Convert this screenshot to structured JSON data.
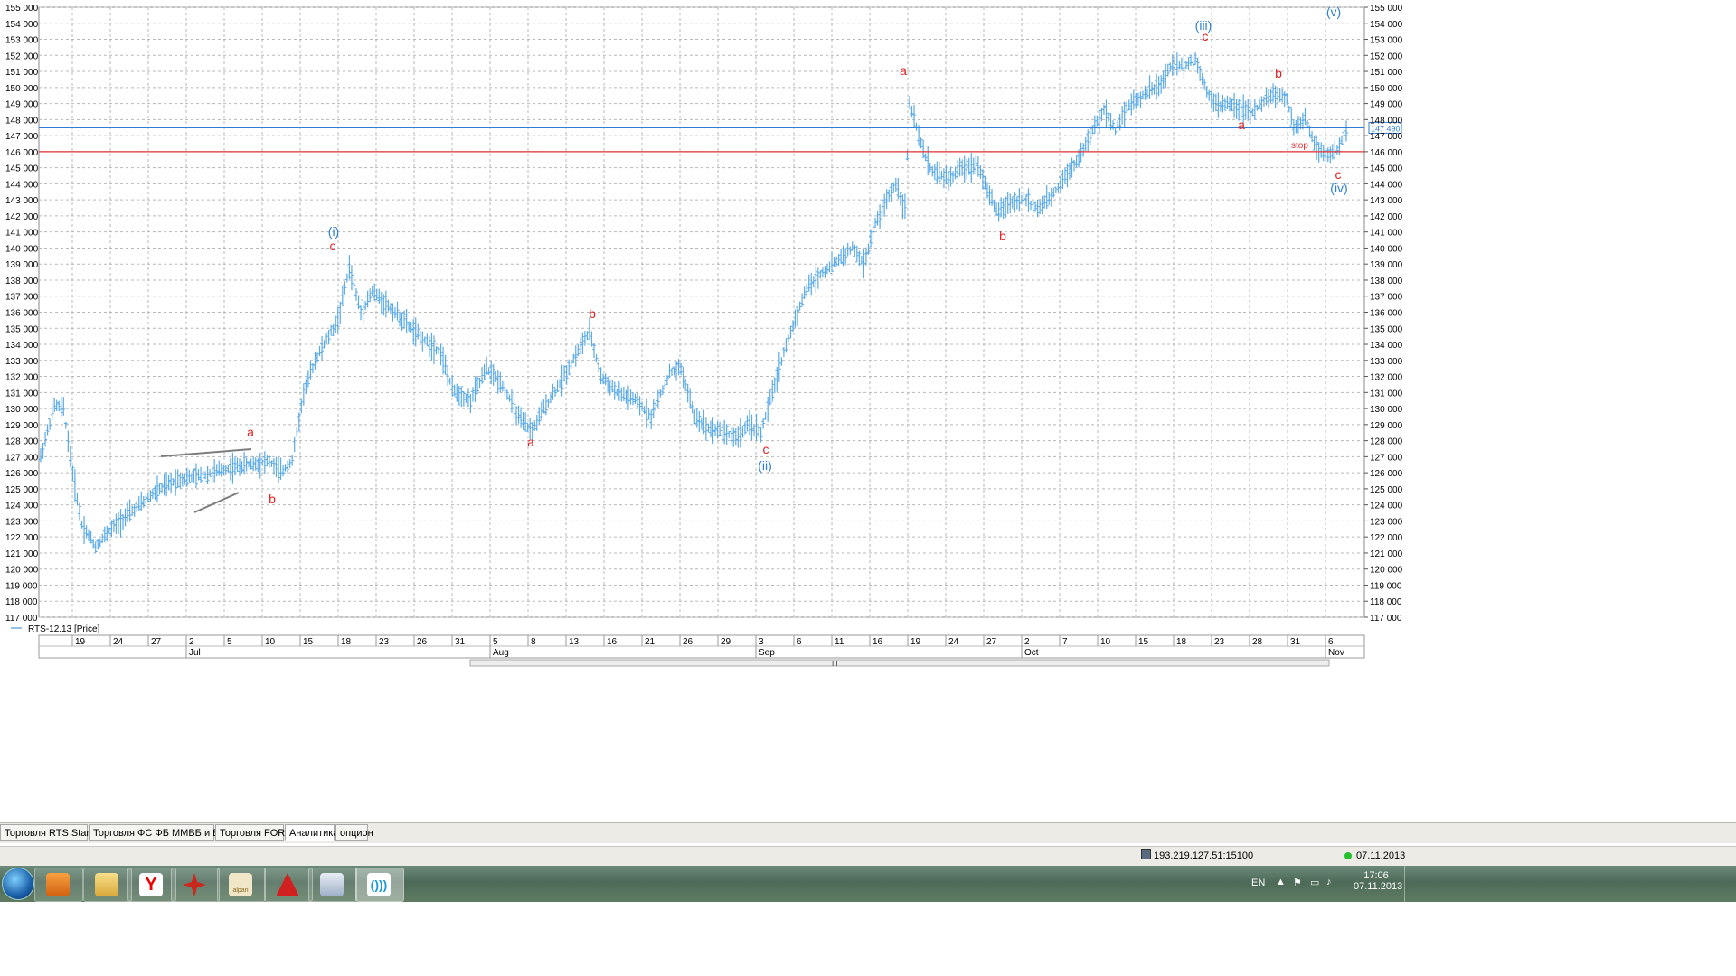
{
  "chart_data": {
    "type": "candlestick",
    "series_label": "RTS-12.13 [Price]",
    "ylim": [
      117000,
      155000
    ],
    "y_ticks": [
      "117 000",
      "118 000",
      "119 000",
      "120 000",
      "121 000",
      "122 000",
      "123 000",
      "124 000",
      "125 000",
      "126 000",
      "127 000",
      "128 000",
      "129 000",
      "130 000",
      "131 000",
      "132 000",
      "133 000",
      "134 000",
      "135 000",
      "136 000",
      "137 000",
      "138 000",
      "139 000",
      "140 000",
      "141 000",
      "142 000",
      "143 000",
      "144 000",
      "145 000",
      "146 000",
      "147 000",
      "148 000",
      "149 000",
      "150 000",
      "151 000",
      "152 000",
      "153 000",
      "154 000",
      "155 000"
    ],
    "x_day_labels": [
      "19",
      "24",
      "27",
      "2",
      "5",
      "10",
      "15",
      "18",
      "23",
      "26",
      "31",
      "5",
      "8",
      "13",
      "16",
      "21",
      "26",
      "29",
      "3",
      "6",
      "11",
      "16",
      "19",
      "24",
      "27",
      "2",
      "7",
      "10",
      "15",
      "18",
      "23",
      "28",
      "31",
      "6"
    ],
    "x_month_labels": [
      "Jul",
      "Aug",
      "Sep",
      "Oct",
      "Nov"
    ],
    "current_price_label": "147 490",
    "horizontal_lines": [
      {
        "value": 147490,
        "color": "#2e7fd4"
      },
      {
        "value": 146000,
        "color": "#e03030",
        "label": "stop"
      }
    ],
    "price_path_keypoints": [
      [
        0,
        127000
      ],
      [
        6,
        130200
      ],
      [
        10,
        130000
      ],
      [
        14,
        126000
      ],
      [
        18,
        122800
      ],
      [
        24,
        121400
      ],
      [
        30,
        122400
      ],
      [
        40,
        123600
      ],
      [
        50,
        124800
      ],
      [
        60,
        125600
      ],
      [
        70,
        125800
      ],
      [
        80,
        126200
      ],
      [
        90,
        126500
      ],
      [
        100,
        126700
      ],
      [
        105,
        126000
      ],
      [
        110,
        126800
      ],
      [
        115,
        131000
      ],
      [
        120,
        133000
      ],
      [
        130,
        135500
      ],
      [
        135,
        138800
      ],
      [
        140,
        136000
      ],
      [
        145,
        137300
      ],
      [
        155,
        136000
      ],
      [
        165,
        134600
      ],
      [
        175,
        133500
      ],
      [
        180,
        131200
      ],
      [
        188,
        130500
      ],
      [
        195,
        132500
      ],
      [
        202,
        131500
      ],
      [
        210,
        129200
      ],
      [
        215,
        128600
      ],
      [
        220,
        130000
      ],
      [
        228,
        131800
      ],
      [
        235,
        133600
      ],
      [
        240,
        134800
      ],
      [
        245,
        132000
      ],
      [
        252,
        131000
      ],
      [
        260,
        130500
      ],
      [
        267,
        129500
      ],
      [
        275,
        132200
      ],
      [
        280,
        132500
      ],
      [
        286,
        129500
      ],
      [
        292,
        128800
      ],
      [
        298,
        128600
      ],
      [
        304,
        128200
      ],
      [
        310,
        129000
      ],
      [
        315,
        128500
      ],
      [
        320,
        131000
      ],
      [
        325,
        133500
      ],
      [
        330,
        135600
      ],
      [
        335,
        137500
      ],
      [
        342,
        138500
      ],
      [
        350,
        139400
      ],
      [
        355,
        140000
      ],
      [
        360,
        139000
      ],
      [
        365,
        141500
      ],
      [
        370,
        143000
      ],
      [
        374,
        144000
      ],
      [
        378,
        142500
      ],
      [
        380,
        149000
      ],
      [
        382,
        148000
      ],
      [
        386,
        146000
      ],
      [
        390,
        144800
      ],
      [
        397,
        144300
      ],
      [
        403,
        145000
      ],
      [
        410,
        145200
      ],
      [
        414,
        143600
      ],
      [
        418,
        142300
      ],
      [
        424,
        142800
      ],
      [
        430,
        143100
      ],
      [
        436,
        142400
      ],
      [
        442,
        143200
      ],
      [
        448,
        144500
      ],
      [
        454,
        145600
      ],
      [
        460,
        147300
      ],
      [
        465,
        148600
      ],
      [
        470,
        147400
      ],
      [
        475,
        148800
      ],
      [
        480,
        149300
      ],
      [
        485,
        149800
      ],
      [
        490,
        150200
      ],
      [
        495,
        151500
      ],
      [
        500,
        151400
      ],
      [
        505,
        151800
      ],
      [
        510,
        149800
      ],
      [
        515,
        148800
      ],
      [
        520,
        149000
      ],
      [
        525,
        148700
      ],
      [
        530,
        148400
      ],
      [
        535,
        149200
      ],
      [
        540,
        149600
      ],
      [
        545,
        149300
      ],
      [
        548,
        147400
      ],
      [
        553,
        148100
      ],
      [
        557,
        146500
      ],
      [
        562,
        145800
      ],
      [
        567,
        146000
      ],
      [
        571,
        147400
      ]
    ],
    "wave_labels": [
      {
        "text": "a",
        "color": "#e02020",
        "x": 277,
        "y": 483
      },
      {
        "text": "b",
        "color": "#e02020",
        "x": 301,
        "y": 557
      },
      {
        "text": "c",
        "color": "#e02020",
        "x": 368,
        "y": 277
      },
      {
        "text": "(i)",
        "color": "#2e7fd4",
        "x": 369,
        "y": 261
      },
      {
        "text": "a",
        "color": "#e02020",
        "x": 587,
        "y": 494
      },
      {
        "text": "b",
        "color": "#e02020",
        "x": 655,
        "y": 352
      },
      {
        "text": "c",
        "color": "#e02020",
        "x": 847,
        "y": 502
      },
      {
        "text": "(ii)",
        "color": "#2e7fd4",
        "x": 846,
        "y": 520
      },
      {
        "text": "a",
        "color": "#e02020",
        "x": 999,
        "y": 83
      },
      {
        "text": "b",
        "color": "#e02020",
        "x": 1109,
        "y": 266
      },
      {
        "text": "c",
        "color": "#e02020",
        "x": 1333,
        "y": 45
      },
      {
        "text": "(iii)",
        "color": "#2e7fd4",
        "x": 1331,
        "y": 33
      },
      {
        "text": "a",
        "color": "#e02020",
        "x": 1373,
        "y": 143
      },
      {
        "text": "b",
        "color": "#e02020",
        "x": 1414,
        "y": 86
      },
      {
        "text": "c",
        "color": "#e02020",
        "x": 1480,
        "y": 198
      },
      {
        "text": "(iv)",
        "color": "#2e7fd4",
        "x": 1481,
        "y": 213
      },
      {
        "text": "(v)",
        "color": "#2e7fd4",
        "x": 1475,
        "y": 18
      }
    ]
  },
  "tabs": [
    "Торговля RTS Standard",
    "Торговля ФС ФБ ММВБ и БР РТС",
    "Торговля FORTS",
    "Аналитика",
    "опцион"
  ],
  "active_tab": 3,
  "status": {
    "connection": "193.219.127.51:15100",
    "date": "07.11.2013"
  },
  "taskbar": {
    "language": "EN",
    "time": "17:06",
    "date": "07.11.2013",
    "apps": [
      "start-orb",
      "media-player",
      "file-explorer",
      "yandex-browser",
      "trading-terminal",
      "alpari",
      "red-triangle-app",
      "calculator",
      "chat-app"
    ]
  }
}
